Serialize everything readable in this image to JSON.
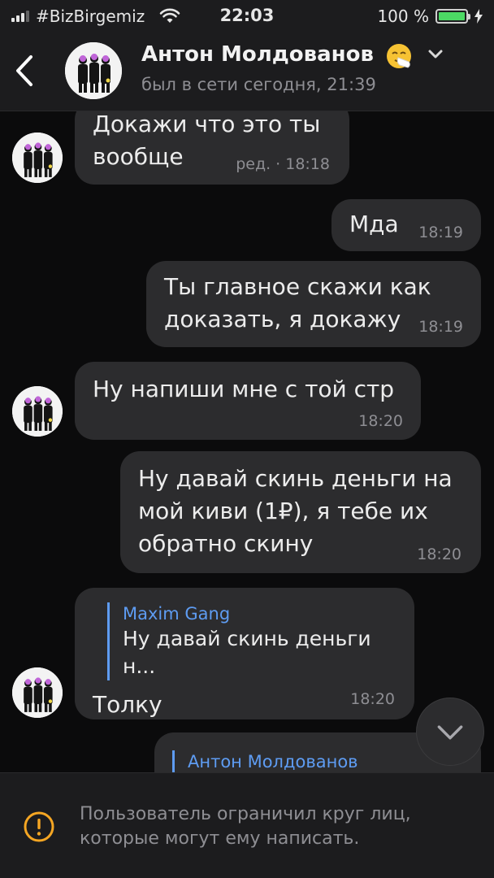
{
  "status_bar": {
    "carrier": "#BizBirgemiz",
    "time": "22:03",
    "battery_percent": "100 %",
    "battery_level": 1.0
  },
  "header": {
    "contact_name": "Антон Молдованов",
    "last_seen": "был в сети сегодня, 21:39",
    "name_emoji": "sneezing-face"
  },
  "messages": [
    {
      "side": "in",
      "text": "Докажи что это ты\nвообще",
      "time": "ред. · 18:18"
    },
    {
      "side": "out",
      "text": "Мда",
      "time": "18:19"
    },
    {
      "side": "out",
      "text": "Ты главное скажи как\nдоказать, я докажу",
      "time": "18:19"
    },
    {
      "side": "in",
      "text": "Ну напиши мне с той стр",
      "time": "18:20"
    },
    {
      "side": "out",
      "text": "Ну давай скинь деньги на\nмой киви (1₽), я тебе их\nобратно скину",
      "time": "18:20"
    },
    {
      "side": "in",
      "reply_name": "Maxim Gang",
      "reply_text": "Ну давай скинь деньги н...",
      "text": "Толку",
      "time": "18:20"
    },
    {
      "side": "out",
      "reply_name": "Антон Молдованов"
    }
  ],
  "footer": {
    "restriction_text": "Пользователь ограничил круг лиц, которые могут ему написать."
  },
  "colors": {
    "background": "#0b0b0c",
    "bar": "#1c1c1e",
    "bubble": "#2c2c2e",
    "accent": "#5e9cf2",
    "warning": "#f5a623",
    "battery": "#4cd964"
  }
}
